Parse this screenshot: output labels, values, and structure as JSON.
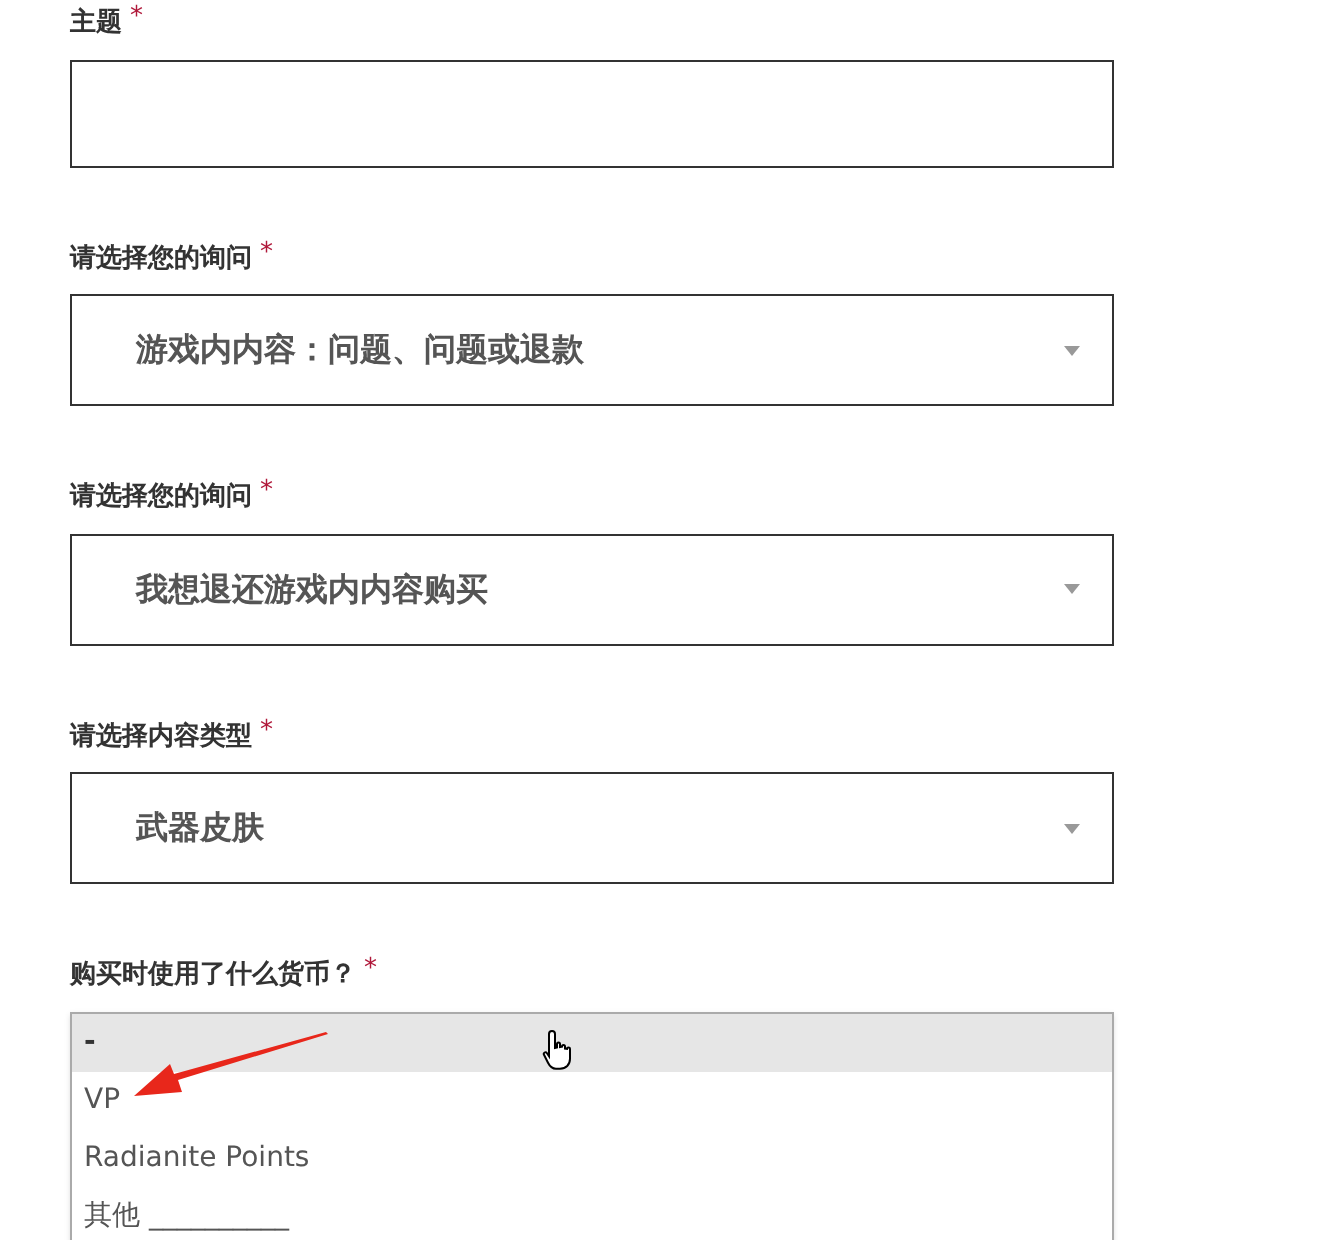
{
  "fields": [
    {
      "kind": "text",
      "label": "主题",
      "required_mark": "*"
    },
    {
      "kind": "select",
      "label": "请选择您的询问",
      "required_mark": "*",
      "value": "游戏内内容：问题、问题或退款"
    },
    {
      "kind": "select",
      "label": "请选择您的询问",
      "required_mark": "*",
      "value": "我想退还游戏内内容购买"
    },
    {
      "kind": "select",
      "label": "请选择内容类型",
      "required_mark": "*",
      "value": "武器皮肤"
    },
    {
      "kind": "dropdown",
      "label": "购买时使用了什么货币？",
      "required_mark": "*",
      "options": [
        {
          "label": "-",
          "selected": true
        },
        {
          "label": "VP",
          "selected": false
        },
        {
          "label": "Radianite Points",
          "selected": false
        },
        {
          "label": "其他 __________",
          "selected": false
        }
      ]
    }
  ]
}
